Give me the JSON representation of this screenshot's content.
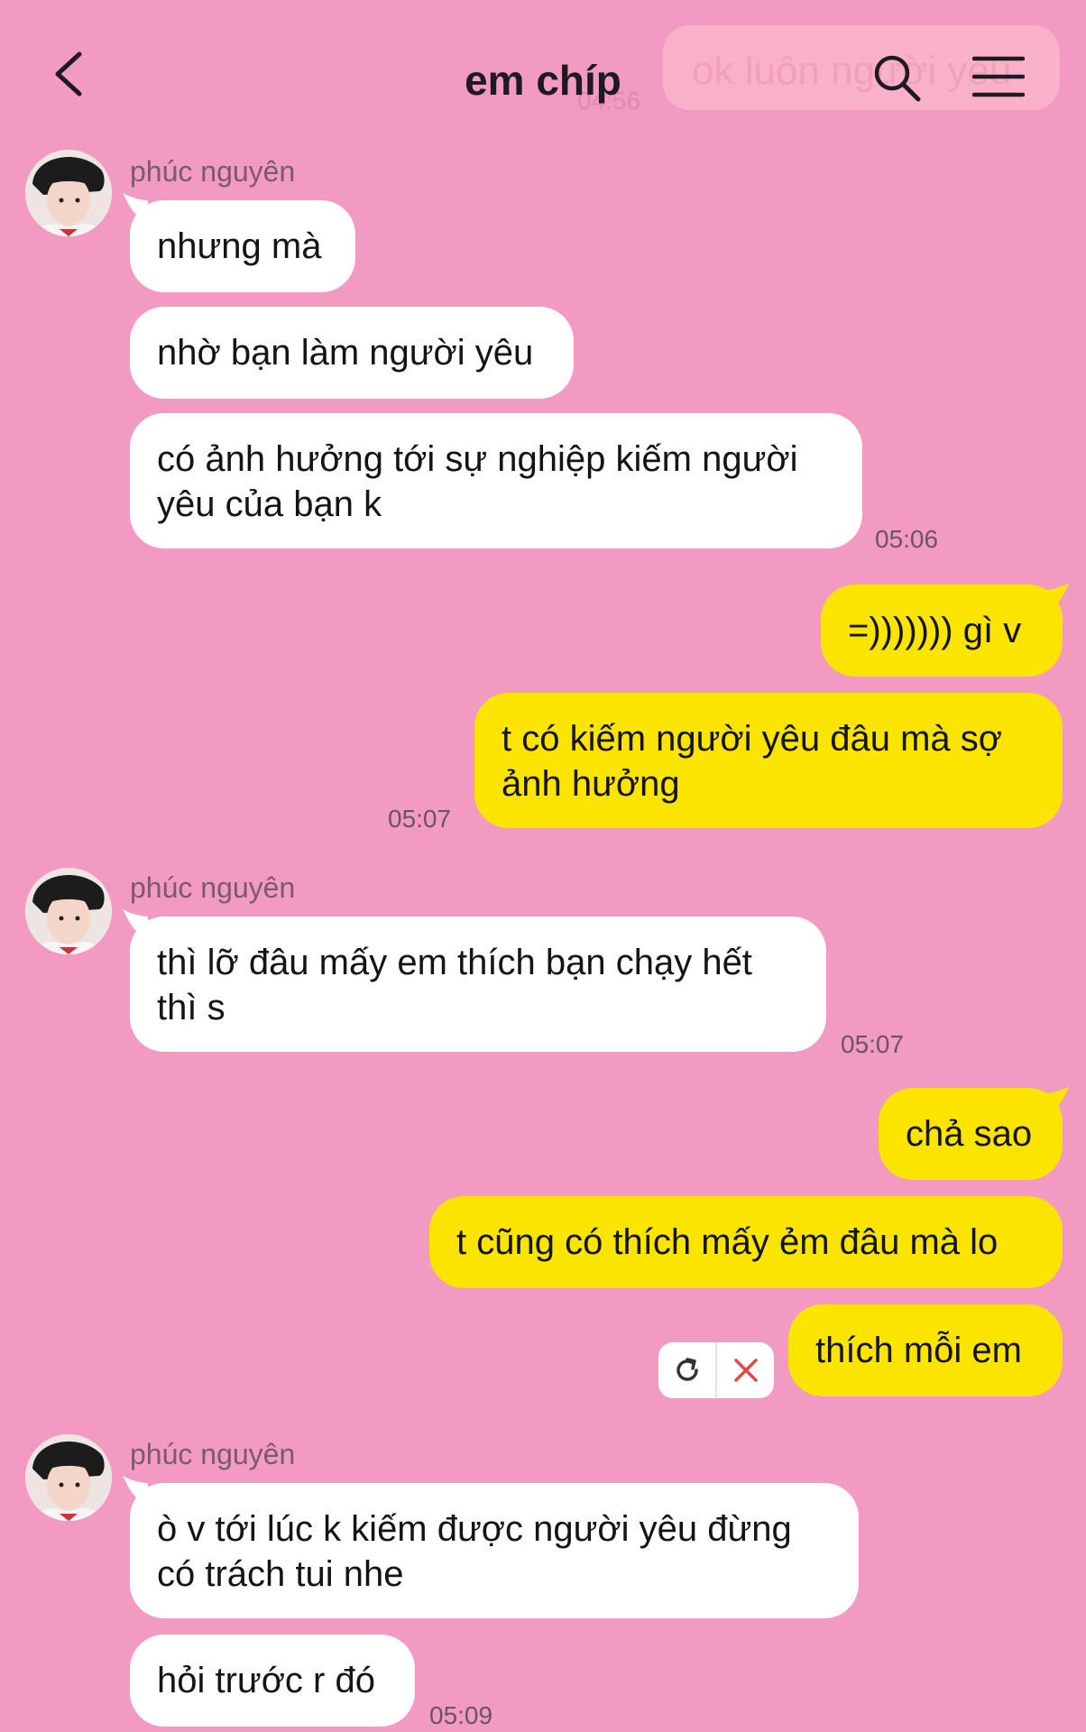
{
  "header": {
    "title": "em chíp",
    "ghost_banner_text": "ok luôn người yêu",
    "ghost_banner_time": "04:56"
  },
  "messages": [
    {
      "sender": "phúc nguyên",
      "text": "nhưng mà"
    },
    {
      "text": "nhờ bạn làm người yêu"
    },
    {
      "text": "có ảnh hưởng tới sự nghiệp kiếm người\nyêu của bạn k",
      "time": "05:06"
    },
    {
      "text": "=))))))) gì v"
    },
    {
      "text": "t có kiếm người yêu đâu mà sợ\nảnh hưởng",
      "time": "05:07"
    },
    {
      "sender": "phúc nguyên",
      "text": "thì lỡ đâu mấy em thích bạn chạy hết\nthì s",
      "time": "05:07"
    },
    {
      "text": "chả sao"
    },
    {
      "text": "t cũng có thích mấy ẻm đâu mà lo"
    },
    {
      "text": "thích mỗi em"
    },
    {
      "sender": "phúc nguyên",
      "text": "ò v tới lúc k kiếm được người yêu đừng\ncó trách tui nhe"
    },
    {
      "text": "hỏi trước r đó",
      "time": "05:09"
    }
  ],
  "colors": {
    "background": "#f29ac2",
    "incoming_bubble": "#ffffff",
    "outgoing_bubble": "#fbe400",
    "text": "#141414",
    "retry_cancel": "#e04747"
  },
  "icons": {
    "back": "chevron-left-icon",
    "search": "search-icon",
    "menu": "hamburger-menu-icon",
    "retry": "refresh-icon",
    "cancel": "close-icon"
  }
}
